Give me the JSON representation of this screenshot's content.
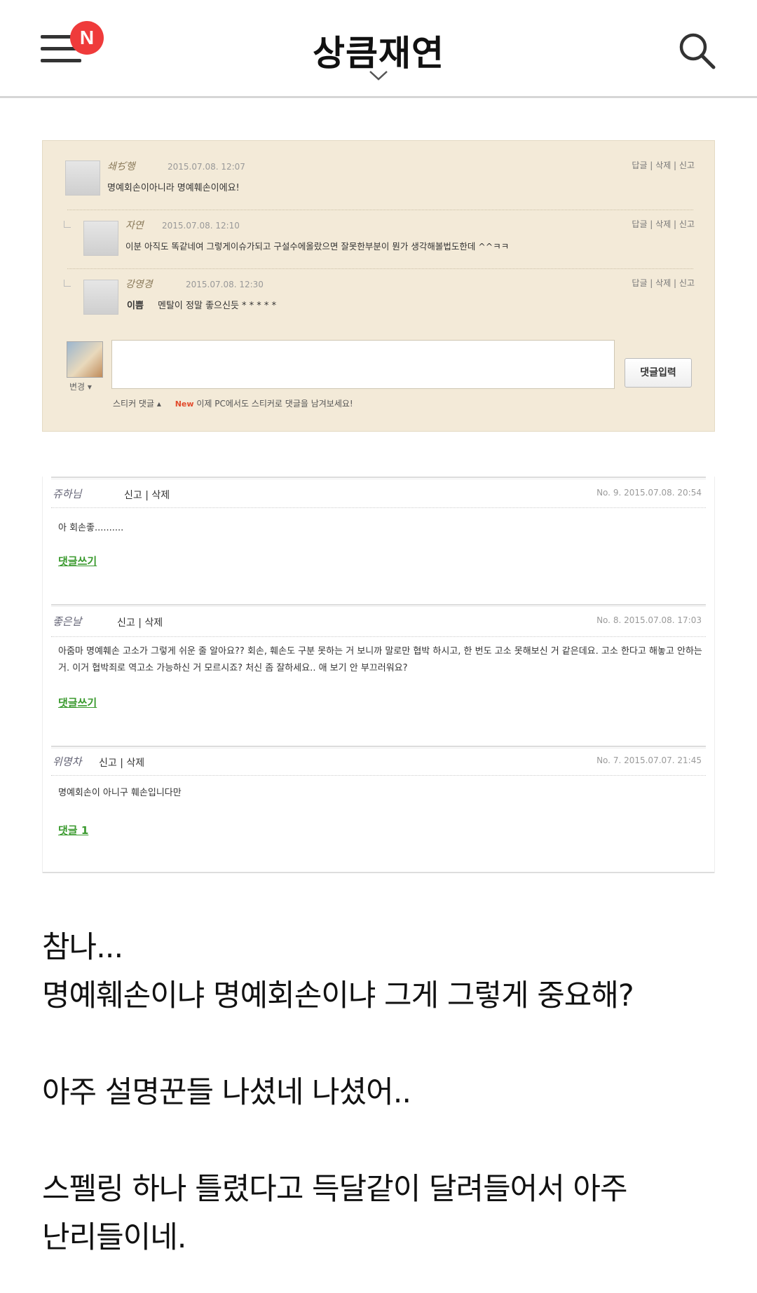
{
  "header": {
    "title": "상큼재연",
    "new_badge": "N",
    "menu_icon": "hamburger-menu-icon",
    "search_icon": "search-icon",
    "badge_color": "#ef3b3b"
  },
  "screenshot1": {
    "comments": [
      {
        "nick": "쇄ぢ행",
        "date": "2015.07.08. 12:07",
        "text": "명예회손이아니라 명예훼손이에요!",
        "actions": "답글 | 삭제 | 신고"
      },
      {
        "nick": "자연",
        "date": "2015.07.08. 12:10",
        "text": "이분 아직도 똑같네여 그렇게이슈가되고 구설수에올랐으면 잘못한부분이 뭔가 생각해볼법도한데 ^^ㅋㅋ",
        "actions": "답글 | 삭제 | 신고"
      },
      {
        "nick": "강영경",
        "date": "2015.07.08. 12:30",
        "text_bold": "이쁨",
        "text": "멘탈이 정말 좋으신듯 * * * * *",
        "actions": "답글 | 삭제 | 신고"
      }
    ],
    "change_label": "변경 ▾",
    "submit_label": "댓글입력",
    "sticker_label": "스티커 댓글 ▴",
    "new_tag": "New",
    "sticker_notice": "이제 PC에서도 스티커로 댓글을 남겨보세요!"
  },
  "screenshot2": {
    "comments": [
      {
        "nick": "쥬하님",
        "meta": "신고 | 삭제",
        "no": "No. 9. 2015.07.08. 20:54",
        "text": "아 회손좋..........",
        "reply": "댓글쓰기"
      },
      {
        "nick": "좋은날",
        "meta": "신고 | 삭제",
        "no": "No. 8. 2015.07.08. 17:03",
        "text": "아줌마 명예훼손 고소가 그렇게 쉬운 줄 알아요?? 회손, 훼손도 구분 못하는 거 보니까 말로만 협박 하시고, 한 번도 고소 못해보신 거 같은데요. 고소 한다고 해놓고 안하는 거. 이거 협박죄로 역고소 가능하신 거 모르시죠? 처신 좀 잘하세요.. 애 보기 안 부끄러워요?",
        "reply": "댓글쓰기"
      },
      {
        "nick": "위명차",
        "meta": "신고 | 삭제",
        "no": "No. 7. 2015.07.07. 21:45",
        "text": "명예회손이 아니구 훼손입니다만",
        "reply": "댓글 1"
      }
    ]
  },
  "post": {
    "lines": [
      "참나...",
      "명예훼손이냐 명예회손이냐 그게 그렇게 중요해?",
      "",
      "아주 설명꾼들 나셨네 나셨어..",
      "",
      "스펠링 하나 틀렸다고 득달같이 달려들어서 아주",
      "난리들이네."
    ]
  }
}
